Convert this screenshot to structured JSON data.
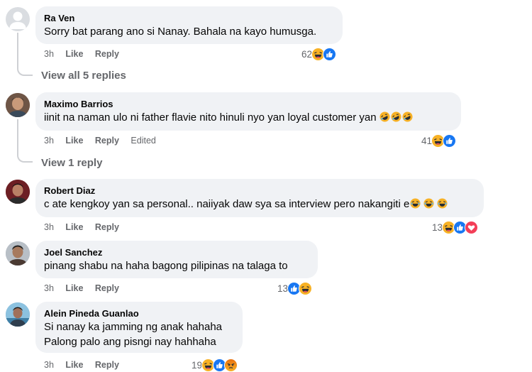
{
  "colors": {
    "bubble": "#f0f2f5",
    "meta_text": "#65676b",
    "like_blue": "#1877f2",
    "haha_yellow": "#f7b125",
    "love_red": "#f33e58",
    "angry_orange": "#e9710f"
  },
  "comments": [
    {
      "author": "Ra Ven",
      "text": "Sorry bat parang ano si Nanay. Bahala na kayo humusga.",
      "time": "3h",
      "like": "Like",
      "reply": "Reply",
      "reaction_count": "62",
      "reaction_icons": [
        "haha-icon",
        "like-icon"
      ],
      "view_replies": "View all 5 replies"
    },
    {
      "author": "Maximo Barrios",
      "text": "iinit na naman ulo ni father flavie nito hinuli nyo yan loyal customer yan",
      "text_emojis": [
        "rofl-emoji",
        "rofl-emoji",
        "rofl-emoji"
      ],
      "time": "3h",
      "like": "Like",
      "reply": "Reply",
      "edited": "Edited",
      "reaction_count": "41",
      "reaction_icons": [
        "haha-icon",
        "like-icon"
      ],
      "view_replies": "View 1 reply"
    },
    {
      "author": "Robert Diaz",
      "text": "c ate kengkoy yan sa personal.. naiiyak daw sya sa interview pero nakangiti e",
      "text_emojis": [
        "joy-emoji",
        "joy-emoji",
        "joy-emoji"
      ],
      "time": "3h",
      "like": "Like",
      "reply": "Reply",
      "reaction_count": "13",
      "reaction_icons": [
        "haha-icon",
        "like-icon",
        "love-icon"
      ]
    },
    {
      "author": "Joel Sanchez",
      "text": "pinang shabu na haha bagong pilipinas na talaga to",
      "time": "3h",
      "like": "Like",
      "reply": "Reply",
      "reaction_count": "13",
      "reaction_icons": [
        "like-icon",
        "haha-icon"
      ]
    },
    {
      "author": "Alein Pineda Guanlao",
      "text_line1": "Si nanay ka jamming ng anak hahaha",
      "text_line2": "Palong palo ang pisngi nay hahhaha",
      "time": "3h",
      "like": "Like",
      "reply": "Reply",
      "reaction_count": "19",
      "reaction_icons": [
        "haha-icon",
        "like-icon",
        "angry-icon"
      ]
    }
  ]
}
